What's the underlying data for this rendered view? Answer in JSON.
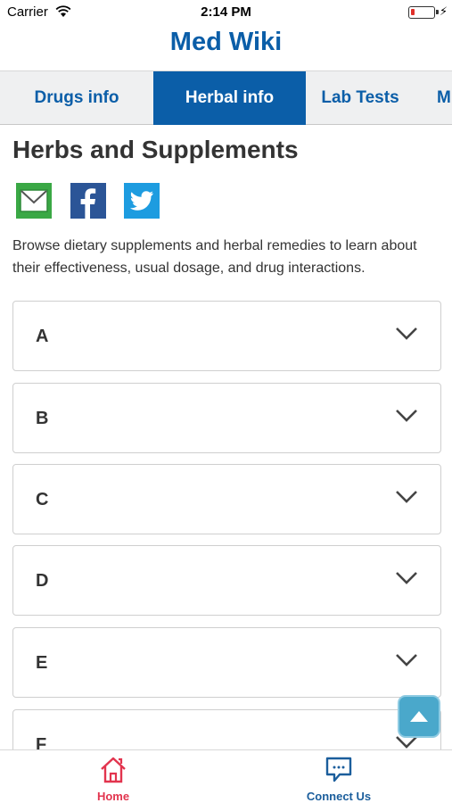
{
  "status_bar": {
    "carrier": "Carrier",
    "time": "2:14 PM"
  },
  "header": {
    "title": "Med Wiki"
  },
  "tabs": [
    {
      "label": "Drugs info",
      "active": false
    },
    {
      "label": "Herbal info",
      "active": true
    },
    {
      "label": "Lab Tests",
      "active": false
    },
    {
      "label": "M",
      "active": false
    }
  ],
  "main": {
    "title": "Herbs and Supplements",
    "share_icons": [
      "email-icon",
      "facebook-icon",
      "twitter-icon"
    ],
    "description": "Browse dietary supplements and herbal remedies to learn about their effectiveness, usual dosage, and drug interactions.",
    "sections": [
      {
        "label": "A"
      },
      {
        "label": "B"
      },
      {
        "label": "C"
      },
      {
        "label": "D"
      },
      {
        "label": "E"
      },
      {
        "label": "F"
      }
    ]
  },
  "bottom_nav": {
    "home_label": "Home",
    "connect_label": "Connect Us"
  },
  "colors": {
    "brand_blue": "#0b5ea8",
    "home_red": "#e2344e",
    "scroll_button": "#4aa8cb"
  }
}
